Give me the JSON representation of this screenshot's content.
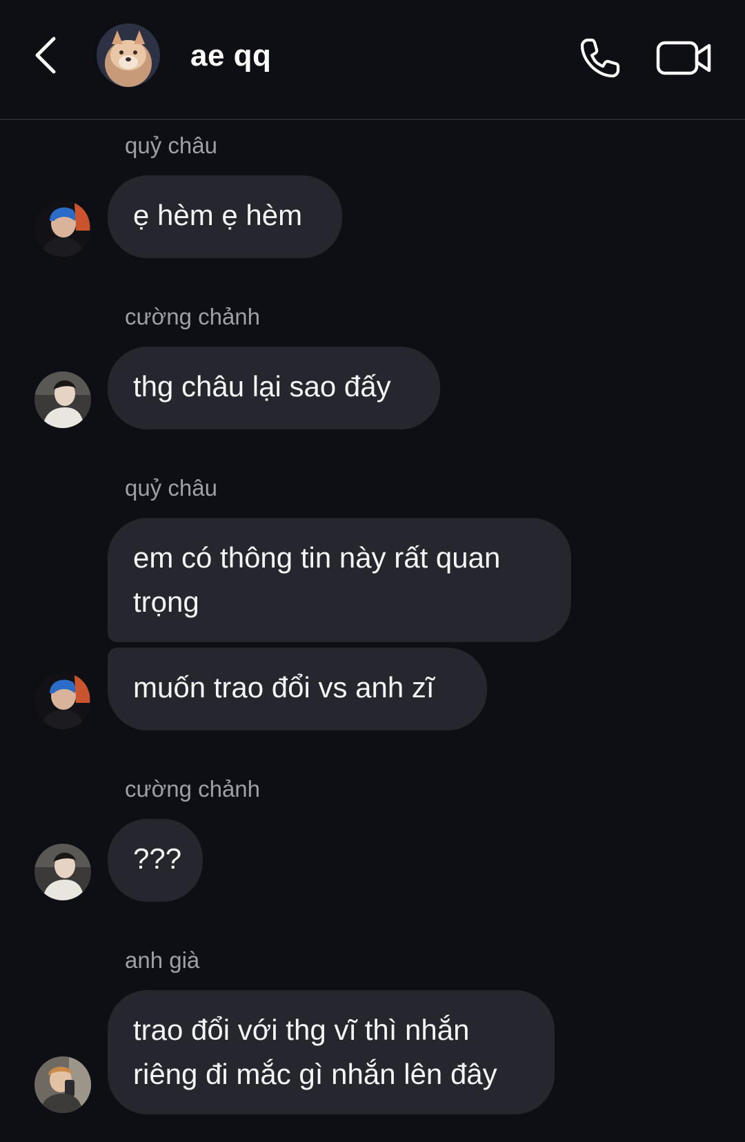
{
  "header": {
    "title": "ae qq",
    "back_icon": "chevron-left-icon",
    "call_icon": "phone-icon",
    "video_icon": "video-camera-icon"
  },
  "messages": [
    {
      "sender": "quỷ châu",
      "text": "ẹ hèm ẹ hèm"
    },
    {
      "sender": "cường chảnh",
      "text": "thg châu lại sao đấy"
    },
    {
      "sender": "quỷ châu",
      "text": "em có thông tin này rất quan trọng"
    },
    {
      "sender": "",
      "text": "muốn trao đổi vs anh zĩ"
    },
    {
      "sender": "cường chảnh",
      "text": "???"
    },
    {
      "sender": "anh già",
      "text": "trao đổi với thg vĩ thì nhắn riêng đi mắc gì nhắn lên đây"
    }
  ]
}
